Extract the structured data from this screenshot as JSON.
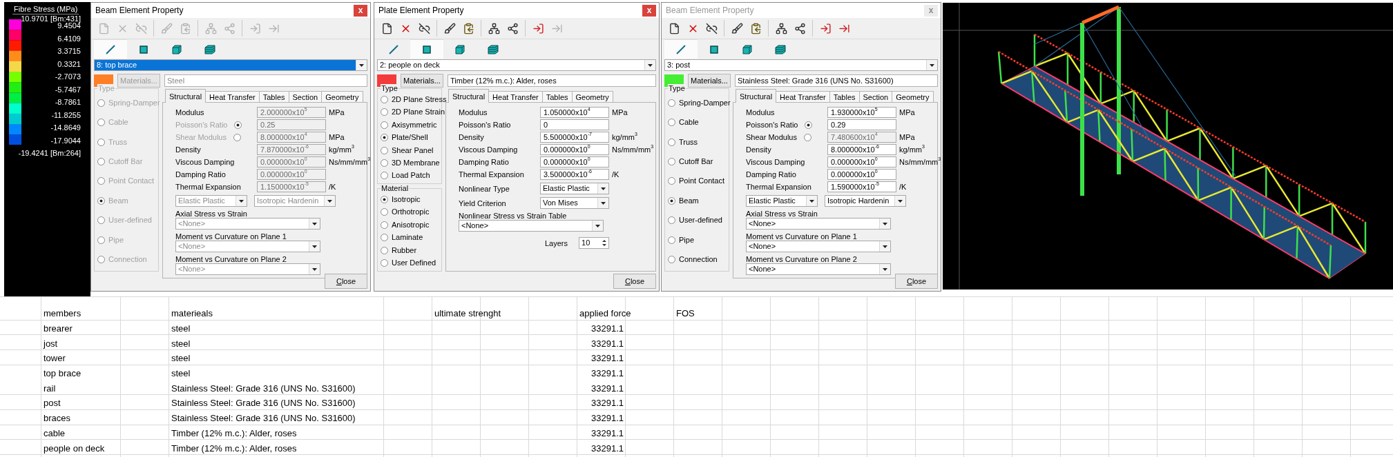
{
  "legend": {
    "title": "Fibre Stress (MPa)",
    "labels": [
      "10.9701 [Bm:431]",
      "9.4504",
      "6.4109",
      "3.3715",
      "0.3321",
      "-2.7073",
      "-5.7467",
      "-8.7861",
      "-11.8255",
      "-14.8649",
      "-17.9044",
      "-19.4241 [Bm:264]"
    ]
  },
  "dialogs": [
    {
      "title": "Beam Element Property",
      "active": true,
      "close_icon": "x",
      "toolbar": [
        {
          "kind": "new",
          "disabled": true
        },
        {
          "kind": "delete",
          "disabled": true
        },
        {
          "kind": "unlink",
          "disabled": true
        },
        {
          "kind": "edit",
          "disabled": true
        },
        {
          "kind": "paste",
          "disabled": true
        },
        {
          "kind": "assign",
          "disabled": true
        },
        {
          "kind": "pick",
          "disabled": true
        },
        {
          "kind": "export",
          "disabled": true
        },
        {
          "kind": "import",
          "disabled": true
        }
      ],
      "element_tabs": [
        {
          "kind": "line",
          "selected": true
        },
        {
          "kind": "square",
          "selected": false
        },
        {
          "kind": "cube",
          "selected": false
        },
        {
          "kind": "layers",
          "selected": false
        }
      ],
      "property": {
        "value": "8: top brace",
        "focused": true
      },
      "color": "#ff7f27",
      "materials_button": {
        "label": "Materials...",
        "disabled": true
      },
      "material_name": {
        "value": "Steel",
        "disabled": true
      },
      "groups": [
        {
          "label": "Type",
          "disabled": true,
          "options": [
            {
              "label": "Spring-Damper",
              "selected": false
            },
            {
              "label": "Cable",
              "selected": false
            },
            {
              "label": "Truss",
              "selected": false
            },
            {
              "label": "Cutoff Bar",
              "selected": false
            },
            {
              "label": "Point Contact",
              "selected": false
            },
            {
              "label": "Beam",
              "selected": true
            },
            {
              "label": "User-defined",
              "selected": false
            },
            {
              "label": "Pipe",
              "selected": false
            },
            {
              "label": "Connection",
              "selected": false
            }
          ]
        }
      ],
      "tabs": [
        {
          "label": "Structural",
          "selected": true
        },
        {
          "label": "Heat Transfer",
          "selected": false
        },
        {
          "label": "Tables",
          "selected": false
        },
        {
          "label": "Section",
          "selected": false
        },
        {
          "label": "Geometry",
          "selected": false
        }
      ],
      "rows": [
        {
          "kind": "field",
          "label": "Modulus",
          "value": "2.000000x10$^{5}$",
          "unit": "MPa",
          "disabled": true
        },
        {
          "kind": "radio-field",
          "label": "Poisson's Ratio",
          "selected": true,
          "label_disabled": true,
          "value": "0.25",
          "disabled": true
        },
        {
          "kind": "radio-field",
          "label": "Shear Modulus",
          "selected": false,
          "label_disabled": true,
          "value": "8.000000x10$^{4}$",
          "unit": "MPa",
          "disabled": true
        },
        {
          "kind": "field",
          "label": "Density",
          "value": "7.870000x10$^{-6}$",
          "unit": "kg/mm$^{3}$",
          "disabled": true
        },
        {
          "kind": "field",
          "label": "Viscous Damping",
          "value": "0.000000x10$^{0}$",
          "unit": "Ns/mm/mm$^{3}$",
          "disabled": true
        },
        {
          "kind": "field",
          "label": "Damping Ratio",
          "value": "0.000000x10$^{0}$",
          "disabled": true
        },
        {
          "kind": "field",
          "label": "Thermal Expansion",
          "value": "1.150000x10$^{-5}$",
          "unit": "/K",
          "disabled": true
        },
        {
          "kind": "select-pair",
          "selects": [
            {
              "value": "Elastic Plastic",
              "disabled": true
            },
            {
              "value": "Isotropic Hardenin",
              "disabled": true
            }
          ]
        },
        {
          "kind": "labeled-select",
          "label": "Axial Stress vs Strain",
          "value": "<None>",
          "disabled": true
        },
        {
          "kind": "labeled-select",
          "label": "Moment vs Curvature on Plane 1",
          "value": "<None>",
          "disabled": true
        },
        {
          "kind": "labeled-select",
          "label": "Moment vs Curvature on Plane 2",
          "value": "<None>",
          "disabled": true
        }
      ],
      "close_button": "Close"
    },
    {
      "title": "Plate Element Property",
      "active": true,
      "close_icon": "x",
      "toolbar": [
        {
          "kind": "new",
          "disabled": false
        },
        {
          "kind": "delete",
          "disabled": false
        },
        {
          "kind": "unlink",
          "disabled": false
        },
        {
          "kind": "edit",
          "disabled": false
        },
        {
          "kind": "paste",
          "disabled": false
        },
        {
          "kind": "assign",
          "disabled": false
        },
        {
          "kind": "pick",
          "disabled": false
        },
        {
          "kind": "export",
          "disabled": false
        },
        {
          "kind": "import",
          "disabled": true
        }
      ],
      "element_tabs": [
        {
          "kind": "line",
          "selected": false
        },
        {
          "kind": "square",
          "selected": true
        },
        {
          "kind": "cube",
          "selected": false
        },
        {
          "kind": "layers",
          "selected": false
        }
      ],
      "property": {
        "value": "2: people on deck",
        "focused": false
      },
      "color": "#f43b3b",
      "materials_button": {
        "label": "Materials...",
        "disabled": false
      },
      "material_name": {
        "value": "Timber (12% m.c.): Alder, roses",
        "disabled": false
      },
      "groups": [
        {
          "label": "Type",
          "disabled": false,
          "options": [
            {
              "label": "2D Plane Stress",
              "selected": false
            },
            {
              "label": "2D Plane Strain",
              "selected": false
            },
            {
              "label": "Axisymmetric",
              "selected": false
            },
            {
              "label": "Plate/Shell",
              "selected": true
            },
            {
              "label": "Shear Panel",
              "selected": false
            },
            {
              "label": "3D Membrane",
              "selected": false
            },
            {
              "label": "Load Patch",
              "selected": false
            }
          ]
        },
        {
          "label": "Material",
          "disabled": false,
          "options": [
            {
              "label": "Isotropic",
              "selected": true
            },
            {
              "label": "Orthotropic",
              "selected": false
            },
            {
              "label": "Anisotropic",
              "selected": false
            },
            {
              "label": "Laminate",
              "selected": false
            },
            {
              "label": "Rubber",
              "selected": false
            },
            {
              "label": "User Defined",
              "selected": false
            }
          ]
        }
      ],
      "tabs": [
        {
          "label": "Structural",
          "selected": true
        },
        {
          "label": "Heat Transfer",
          "selected": false
        },
        {
          "label": "Tables",
          "selected": false
        },
        {
          "label": "Geometry",
          "selected": false
        }
      ],
      "rows": [
        {
          "kind": "field",
          "label": "Modulus",
          "value": "1.050000x10$^{4}$",
          "unit": "MPa",
          "disabled": false
        },
        {
          "kind": "field",
          "label": "Poisson's Ratio",
          "value": "0",
          "disabled": false
        },
        {
          "kind": "field",
          "label": "Density",
          "value": "5.500000x10$^{-7}$",
          "unit": "kg/mm$^{3}$",
          "disabled": false
        },
        {
          "kind": "field",
          "label": "Viscous Damping",
          "value": "0.000000x10$^{0}$",
          "unit": "Ns/mm/mm$^{3}$",
          "disabled": false
        },
        {
          "kind": "field",
          "label": "Damping Ratio",
          "value": "0.000000x10$^{0}$",
          "disabled": false
        },
        {
          "kind": "field",
          "label": "Thermal Expansion",
          "value": "3.500000x10$^{-6}$",
          "unit": "/K",
          "disabled": false
        },
        {
          "kind": "inline-select",
          "label": "Nonlinear Type",
          "value": "Elastic Plastic",
          "disabled": false
        },
        {
          "kind": "inline-select",
          "label": "Yield Criterion",
          "value": "Von Mises",
          "disabled": false
        },
        {
          "kind": "labeled-select",
          "label": "Nonlinear Stress vs Strain Table",
          "value": "<None>",
          "disabled": false
        },
        {
          "kind": "spinner",
          "label": "Layers",
          "value": "10"
        }
      ],
      "close_button": "Close"
    },
    {
      "title": "Beam Element Property",
      "active": false,
      "close_icon": "x",
      "toolbar": [
        {
          "kind": "new",
          "disabled": false
        },
        {
          "kind": "delete",
          "disabled": false
        },
        {
          "kind": "unlink",
          "disabled": false
        },
        {
          "kind": "edit",
          "disabled": false
        },
        {
          "kind": "paste",
          "disabled": false
        },
        {
          "kind": "assign",
          "disabled": false
        },
        {
          "kind": "pick",
          "disabled": false
        },
        {
          "kind": "export",
          "disabled": false
        },
        {
          "kind": "import",
          "disabled": false
        }
      ],
      "element_tabs": [
        {
          "kind": "line",
          "selected": true
        },
        {
          "kind": "square",
          "selected": false
        },
        {
          "kind": "cube",
          "selected": false
        },
        {
          "kind": "layers",
          "selected": false
        }
      ],
      "property": {
        "value": "3: post",
        "focused": false
      },
      "color": "#44ee33",
      "materials_button": {
        "label": "Materials...",
        "disabled": false
      },
      "material_name": {
        "value": "Stainless Steel: Grade 316 (UNS No. S31600)",
        "disabled": false
      },
      "groups": [
        {
          "label": "Type",
          "disabled": false,
          "options": [
            {
              "label": "Spring-Damper",
              "selected": false
            },
            {
              "label": "Cable",
              "selected": false
            },
            {
              "label": "Truss",
              "selected": false
            },
            {
              "label": "Cutoff Bar",
              "selected": false
            },
            {
              "label": "Point Contact",
              "selected": false
            },
            {
              "label": "Beam",
              "selected": true
            },
            {
              "label": "User-defined",
              "selected": false
            },
            {
              "label": "Pipe",
              "selected": false
            },
            {
              "label": "Connection",
              "selected": false
            }
          ]
        }
      ],
      "tabs": [
        {
          "label": "Structural",
          "selected": true
        },
        {
          "label": "Heat Transfer",
          "selected": false
        },
        {
          "label": "Tables",
          "selected": false
        },
        {
          "label": "Section",
          "selected": false
        },
        {
          "label": "Geometry",
          "selected": false
        }
      ],
      "rows": [
        {
          "kind": "field",
          "label": "Modulus",
          "value": "1.930000x10$^{5}$",
          "unit": "MPa",
          "disabled": false
        },
        {
          "kind": "radio-field",
          "label": "Poisson's Ratio",
          "selected": true,
          "label_disabled": false,
          "value": "0.29",
          "disabled": false
        },
        {
          "kind": "radio-field",
          "label": "Shear Modulus",
          "selected": false,
          "label_disabled": false,
          "value": "7.480600x10$^{4}$",
          "unit": "MPa",
          "disabled": true
        },
        {
          "kind": "field",
          "label": "Density",
          "value": "8.000000x10$^{-6}$",
          "unit": "kg/mm$^{3}$",
          "disabled": false
        },
        {
          "kind": "field",
          "label": "Viscous Damping",
          "value": "0.000000x10$^{0}$",
          "unit": "Ns/mm/mm$^{3}$",
          "disabled": false
        },
        {
          "kind": "field",
          "label": "Damping Ratio",
          "value": "0.000000x10$^{0}$",
          "disabled": false
        },
        {
          "kind": "field",
          "label": "Thermal Expansion",
          "value": "1.590000x10$^{-5}$",
          "unit": "/K",
          "disabled": false
        },
        {
          "kind": "select-pair",
          "selects": [
            {
              "value": "Elastic Plastic",
              "disabled": false
            },
            {
              "value": "Isotropic Hardenin",
              "disabled": false
            }
          ]
        },
        {
          "kind": "labeled-select",
          "label": "Axial Stress vs Strain",
          "value": "<None>",
          "disabled": false
        },
        {
          "kind": "labeled-select",
          "label": "Moment vs Curvature on Plane 1",
          "value": "<None>",
          "disabled": false
        },
        {
          "kind": "labeled-select",
          "label": "Moment vs Curvature on Plane 2",
          "value": "<None>",
          "disabled": false
        }
      ],
      "close_button": "Close"
    }
  ],
  "sheet": {
    "columns": [
      "members",
      "materieals",
      "ultimate strenght",
      "applied force",
      "FOS"
    ],
    "rows": [
      {
        "member": "brearer",
        "material": "steel",
        "applied_force": "33291.1"
      },
      {
        "member": "jost",
        "material": "steel",
        "applied_force": "33291.1"
      },
      {
        "member": "tower",
        "material": "steel",
        "applied_force": "33291.1"
      },
      {
        "member": "top brace",
        "material": "steel",
        "applied_force": "33291.1"
      },
      {
        "member": "rail",
        "material": "Stainless Steel: Grade 316 (UNS No. S31600)",
        "applied_force": "33291.1"
      },
      {
        "member": "post",
        "material": "Stainless Steel: Grade 316 (UNS No. S31600)",
        "applied_force": "33291.1"
      },
      {
        "member": "braces",
        "material": "Stainless Steel: Grade 316 (UNS No. S31600)",
        "applied_force": "33291.1"
      },
      {
        "member": "cable",
        "material": "Timber (12% m.c.): Alder, roses",
        "applied_force": "33291.1"
      },
      {
        "member": "people on deck",
        "material": "Timber (12% m.c.): Alder, roses",
        "applied_force": "33291.1"
      }
    ]
  }
}
